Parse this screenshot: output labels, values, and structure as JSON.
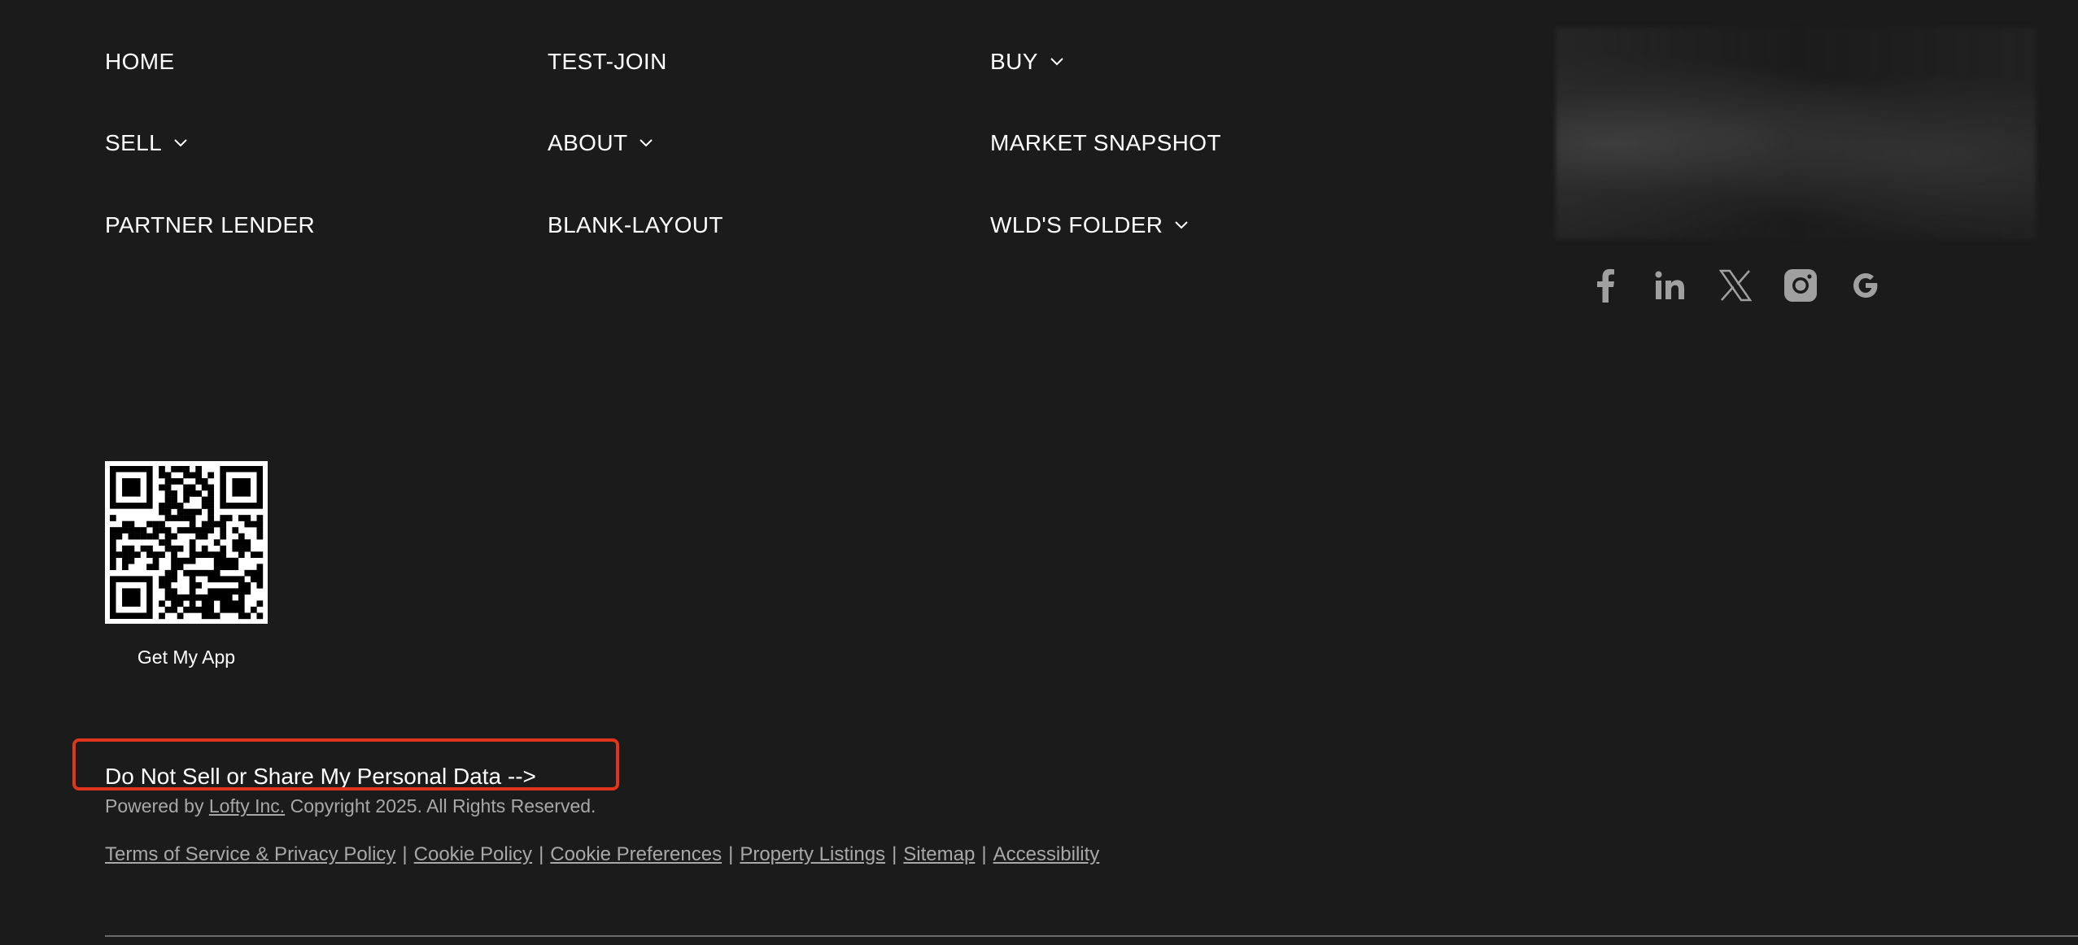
{
  "nav": {
    "home": "HOME",
    "test_join": "TEST-JOIN",
    "buy": "BUY",
    "sell": "SELL",
    "about": "ABOUT",
    "market_snapshot": "MARKET SNAPSHOT",
    "partner_lender": "PARTNER LENDER",
    "blank_layout": "BLANK-LAYOUT",
    "wlds_folder": "WLD'S FOLDER"
  },
  "social": {
    "icons": [
      "facebook-icon",
      "linkedin-icon",
      "x-twitter-icon",
      "instagram-icon",
      "google-icon"
    ]
  },
  "app": {
    "caption": "Get My App"
  },
  "privacy": {
    "link_label": "Do Not Sell or Share My Personal Data -->",
    "highlight_color": "#e0341c"
  },
  "powered": {
    "prefix": "Powered by",
    "company": "Lofty Inc.",
    "copyright": "Copyright 2025. All Rights Reserved."
  },
  "legal": {
    "terms": "Terms of Service & Privacy Policy",
    "cookie_policy": "Cookie Policy",
    "cookie_preferences": "Cookie Preferences",
    "property_listings": "Property Listings",
    "sitemap": "Sitemap",
    "accessibility": "Accessibility",
    "separator": "|"
  },
  "colors": {
    "background": "#1b1b1b",
    "text": "#ffffff",
    "muted": "#a8a8a8",
    "icon": "#a0a0a0"
  }
}
